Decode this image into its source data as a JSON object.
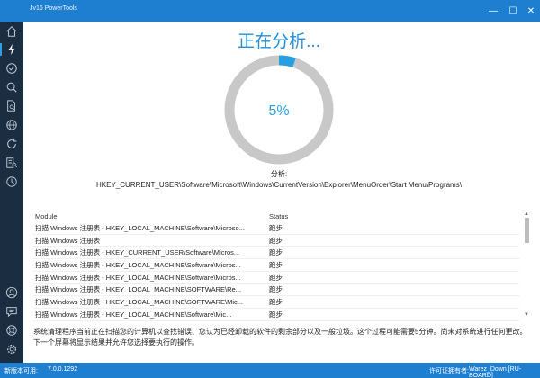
{
  "window": {
    "title": "Jv16 PowerTools",
    "minimize_glyph": "—",
    "maximize_glyph": "☐",
    "close_glyph": "✕"
  },
  "sidebar": {
    "top_items": [
      {
        "icon": "home-icon"
      },
      {
        "icon": "lightning-icon",
        "active": true
      },
      {
        "icon": "check-circle-icon"
      },
      {
        "icon": "search-icon"
      },
      {
        "icon": "file-search-icon"
      },
      {
        "icon": "globe-icon"
      },
      {
        "icon": "refresh-icon"
      },
      {
        "icon": "document-search-icon"
      },
      {
        "icon": "clock-icon"
      }
    ],
    "bottom_items": [
      {
        "icon": "user-icon"
      },
      {
        "icon": "chat-icon"
      },
      {
        "icon": "help-icon"
      },
      {
        "icon": "settings-icon"
      }
    ]
  },
  "scan": {
    "heading": "正在分析...",
    "progress_percent": 5,
    "progress_label": "5%",
    "analysis_label": "分析:",
    "analysis_path": "HKEY_CURRENT_USER\\Software\\Microsoft\\Windows\\CurrentVersion\\Explorer\\MenuOrder\\Start Menu\\Programs\\",
    "colors": {
      "accent": "#2a9fdf",
      "track": "#c8c8c8"
    }
  },
  "table": {
    "columns": [
      "Module",
      "Status"
    ],
    "rows": [
      {
        "module": "扫描 Windows 注册表 - HKEY_LOCAL_MACHINE\\Software\\Microso...",
        "status": "跑步"
      },
      {
        "module": "扫描 Windows 注册表",
        "status": "跑步"
      },
      {
        "module": "扫描 Windows 注册表 - HKEY_CURRENT_USER\\Software\\Micros...",
        "status": "跑步"
      },
      {
        "module": "扫描 Windows 注册表 - HKEY_LOCAL_MACHINE\\Software\\Micros...",
        "status": "跑步"
      },
      {
        "module": "扫描 Windows 注册表 - HKEY_LOCAL_MACHINE\\Software\\Micros...",
        "status": "跑步"
      },
      {
        "module": "扫描 Windows 注册表 - HKEY_LOCAL_MACHINE\\SOFTWARE\\Re...",
        "status": "跑步"
      },
      {
        "module": "扫描 Windows 注册表 - HKEY_LOCAL_MACHINE\\SOFTWARE\\Mic...",
        "status": "跑步"
      },
      {
        "module": "扫描 Windows 注册表 - HKEY_LOCAL_MACHINE\\Software\\Mic...",
        "status": "跑步"
      }
    ]
  },
  "description": "系统清理程序当前正在扫描您的计算机以查找错误、您认为已经卸载的软件的剩余部分以及一般垃圾。这个过程可能需要5分钟。尚未对系统进行任何更改。下一个屏幕将显示结果并允许您选择要执行的操作。",
  "statusbar": {
    "update_label": "新版本可用:",
    "version": "7.0.0.1292",
    "license_label": "许可证拥有者:",
    "license_owner": "Warez_Down [RU-BOARD]"
  }
}
